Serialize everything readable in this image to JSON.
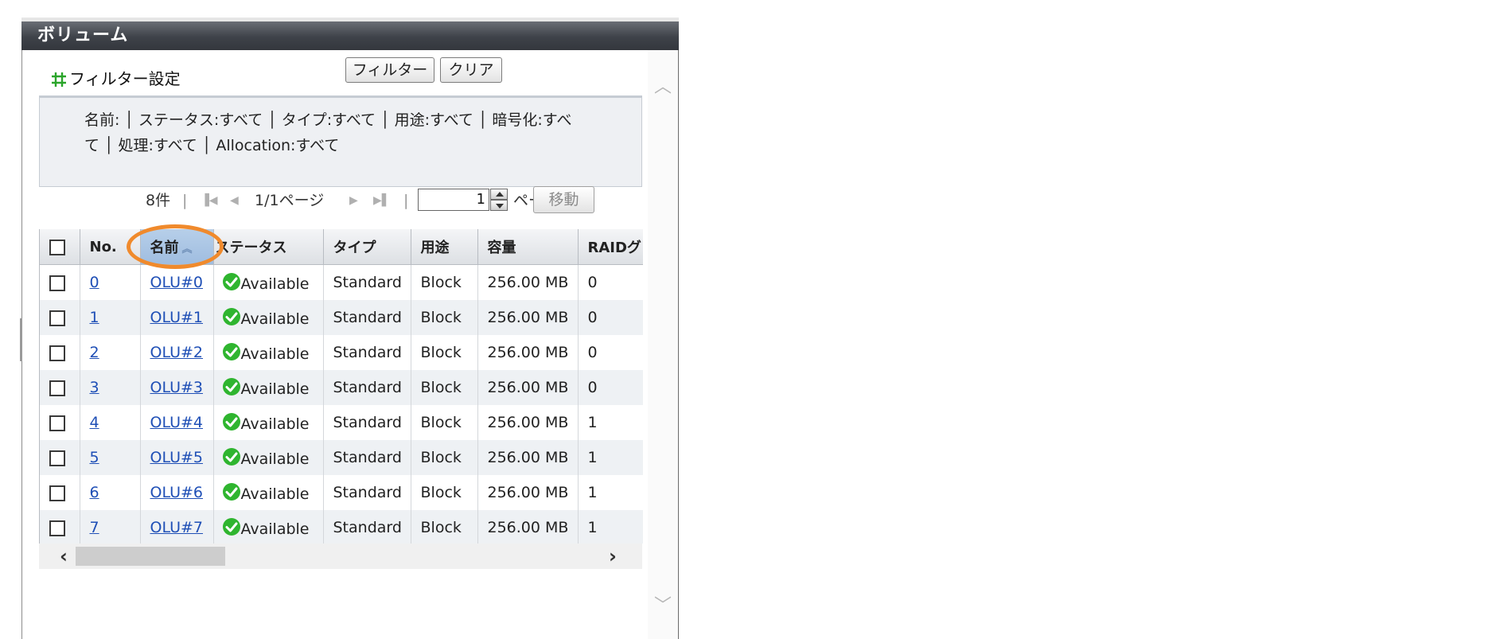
{
  "window": {
    "title": "ボリューム"
  },
  "filter": {
    "title": "フィルター設定",
    "icon": "filter-grid-icon",
    "filter_button": "フィルター",
    "clear_button": "クリア",
    "summary_line1": "名前:  │ ステータス:すべて │ タイプ:すべて │ 用途:すべて │ 暗号化:すべ",
    "summary_line2": "て │ 処理:すべて │ Allocation:すべて"
  },
  "pager": {
    "count": "8件",
    "separator": "|",
    "page_info": "1/1ページ",
    "first_icon": "first-page-icon",
    "prev_icon": "prev-page-icon",
    "next_icon": "next-page-icon",
    "last_icon": "last-page-icon",
    "page_value": "1",
    "page_suffix": "ページ",
    "go_button": "移動"
  },
  "table": {
    "columns": [
      "No.",
      "名前",
      "ステータス",
      "タイプ",
      "用途",
      "容量",
      "RAIDグ"
    ],
    "sorted_column": "名前",
    "sort_direction": "ascending",
    "rows": [
      {
        "no": "0",
        "name": "OLU#0",
        "status": "Available",
        "type": "Standard",
        "usage": "Block",
        "capacity": "256.00 MB",
        "raid": "0"
      },
      {
        "no": "1",
        "name": "OLU#1",
        "status": "Available",
        "type": "Standard",
        "usage": "Block",
        "capacity": "256.00 MB",
        "raid": "0"
      },
      {
        "no": "2",
        "name": "OLU#2",
        "status": "Available",
        "type": "Standard",
        "usage": "Block",
        "capacity": "256.00 MB",
        "raid": "0"
      },
      {
        "no": "3",
        "name": "OLU#3",
        "status": "Available",
        "type": "Standard",
        "usage": "Block",
        "capacity": "256.00 MB",
        "raid": "0"
      },
      {
        "no": "4",
        "name": "OLU#4",
        "status": "Available",
        "type": "Standard",
        "usage": "Block",
        "capacity": "256.00 MB",
        "raid": "1"
      },
      {
        "no": "5",
        "name": "OLU#5",
        "status": "Available",
        "type": "Standard",
        "usage": "Block",
        "capacity": "256.00 MB",
        "raid": "1"
      },
      {
        "no": "6",
        "name": "OLU#6",
        "status": "Available",
        "type": "Standard",
        "usage": "Block",
        "capacity": "256.00 MB",
        "raid": "1"
      },
      {
        "no": "7",
        "name": "OLU#7",
        "status": "Available",
        "type": "Standard",
        "usage": "Block",
        "capacity": "256.00 MB",
        "raid": "1"
      }
    ]
  },
  "colors": {
    "title_bar": "#3e4249",
    "link": "#1f4fb6",
    "sorted_header": "#9fbde0",
    "highlight_circle": "#f08a2c",
    "status_ok": "#2fb52f"
  }
}
